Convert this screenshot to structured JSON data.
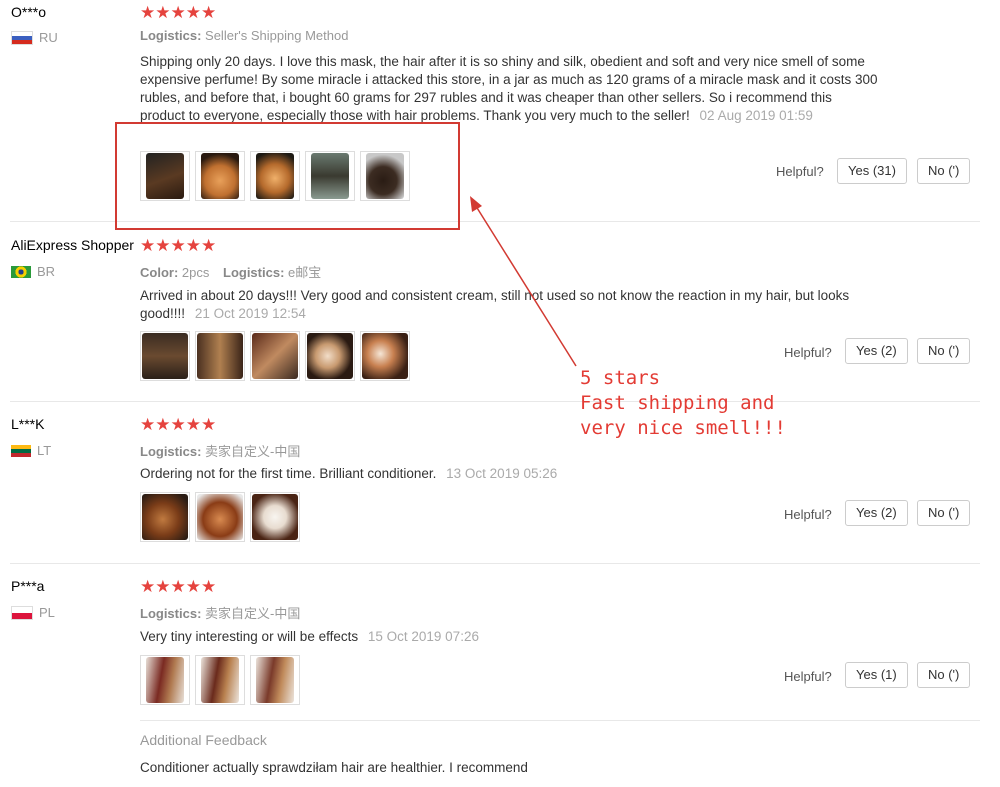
{
  "reviews": [
    {
      "user": "O***o",
      "country": "RU",
      "stars": "★★★★★",
      "meta": [
        {
          "label": "Logistics:",
          "value": "Seller's Shipping Method"
        }
      ],
      "text": "Shipping only 20 days. I love this mask, the hair after it is so shiny and silk, obedient and soft and very nice smell of some expensive perfume! By some miracle i attacked this store, in a jar as much as 120 grams of a miracle mask and it costs 300 rubles, and before that, i bought 60 grams for 297 rubles and it was cheaper than other sellers. So i recommend this product to everyone, especially those with hair problems. Thank you very much to the seller!",
      "date": "02 Aug 2019 01:59",
      "helpful_label": "Helpful?",
      "yes_label": "Yes (31)",
      "no_label": "No (')",
      "thumb_count": 5
    },
    {
      "user": "AliExpress Shopper",
      "country": "BR",
      "stars": "★★★★★",
      "meta": [
        {
          "label": "Color:",
          "value": "2pcs"
        },
        {
          "label": "Logistics:",
          "value": "e邮宝"
        }
      ],
      "text": "Arrived in about 20 days!!! Very good and consistent cream, still not used so not know the reaction in my hair, but looks good!!!!",
      "date": "21 Oct 2019 12:54",
      "helpful_label": "Helpful?",
      "yes_label": "Yes (2)",
      "no_label": "No (')",
      "thumb_count": 5
    },
    {
      "user": "L***K",
      "country": "LT",
      "stars": "★★★★★",
      "meta": [
        {
          "label": "Logistics:",
          "value": "卖家自定义-中国"
        }
      ],
      "text": "Ordering not for the first time. Brilliant conditioner.",
      "date": "13 Oct 2019 05:26",
      "helpful_label": "Helpful?",
      "yes_label": "Yes (2)",
      "no_label": "No (')",
      "thumb_count": 3
    },
    {
      "user": "P***a",
      "country": "PL",
      "stars": "★★★★★",
      "meta": [
        {
          "label": "Logistics:",
          "value": "卖家自定义-中国"
        }
      ],
      "text": "Very tiny interesting or will be effects",
      "date": "15 Oct 2019 07:26",
      "helpful_label": "Helpful?",
      "yes_label": "Yes (1)",
      "no_label": "No (')",
      "thumb_count": 3
    }
  ],
  "additional": {
    "title": "Additional Feedback",
    "text": "Conditioner actually sprawdziłam hair are healthier. I recommend"
  },
  "annotation": {
    "lines": [
      "5 stars",
      "Fast shipping and",
      "very nice smell!!!"
    ],
    "color": "#e33b34"
  },
  "colors": {
    "stars": "#e5433e",
    "annotation_box": "#d23a32"
  }
}
